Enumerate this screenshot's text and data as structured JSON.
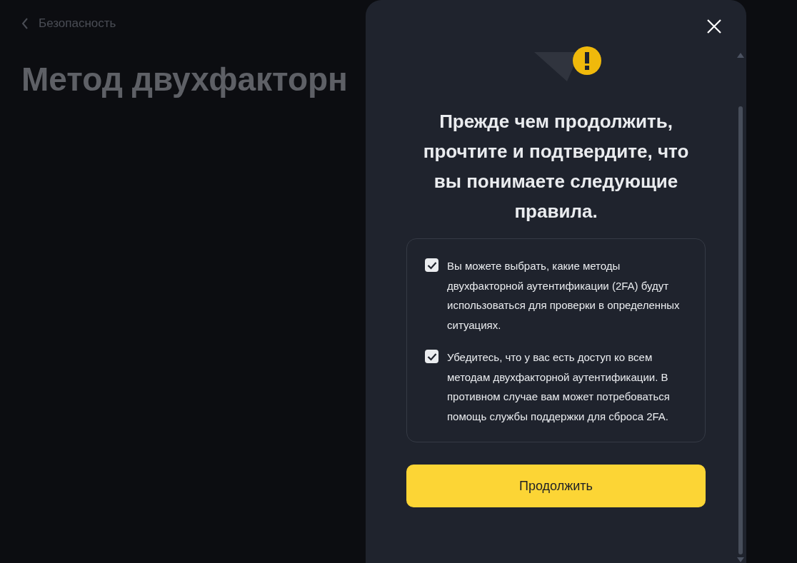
{
  "page": {
    "back_link": "Безопасность",
    "title": "Метод двухфакторн"
  },
  "dialog": {
    "heading": "Прежде чем продолжить, прочтите и подтвердите, что вы понимаете следующие правила.",
    "rules": [
      {
        "text": "Вы можете выбрать, какие методы двухфакторной аутентификации (2FA) будут использоваться для проверки в определенных ситуациях.",
        "checked": true
      },
      {
        "text": "Убедитесь, что у вас есть доступ ко всем методам двухфакторной аутентификации. В противном случае вам может потребоваться помощь службы поддержки для сброса 2FA.",
        "checked": true
      }
    ],
    "button": "Продолжить"
  }
}
